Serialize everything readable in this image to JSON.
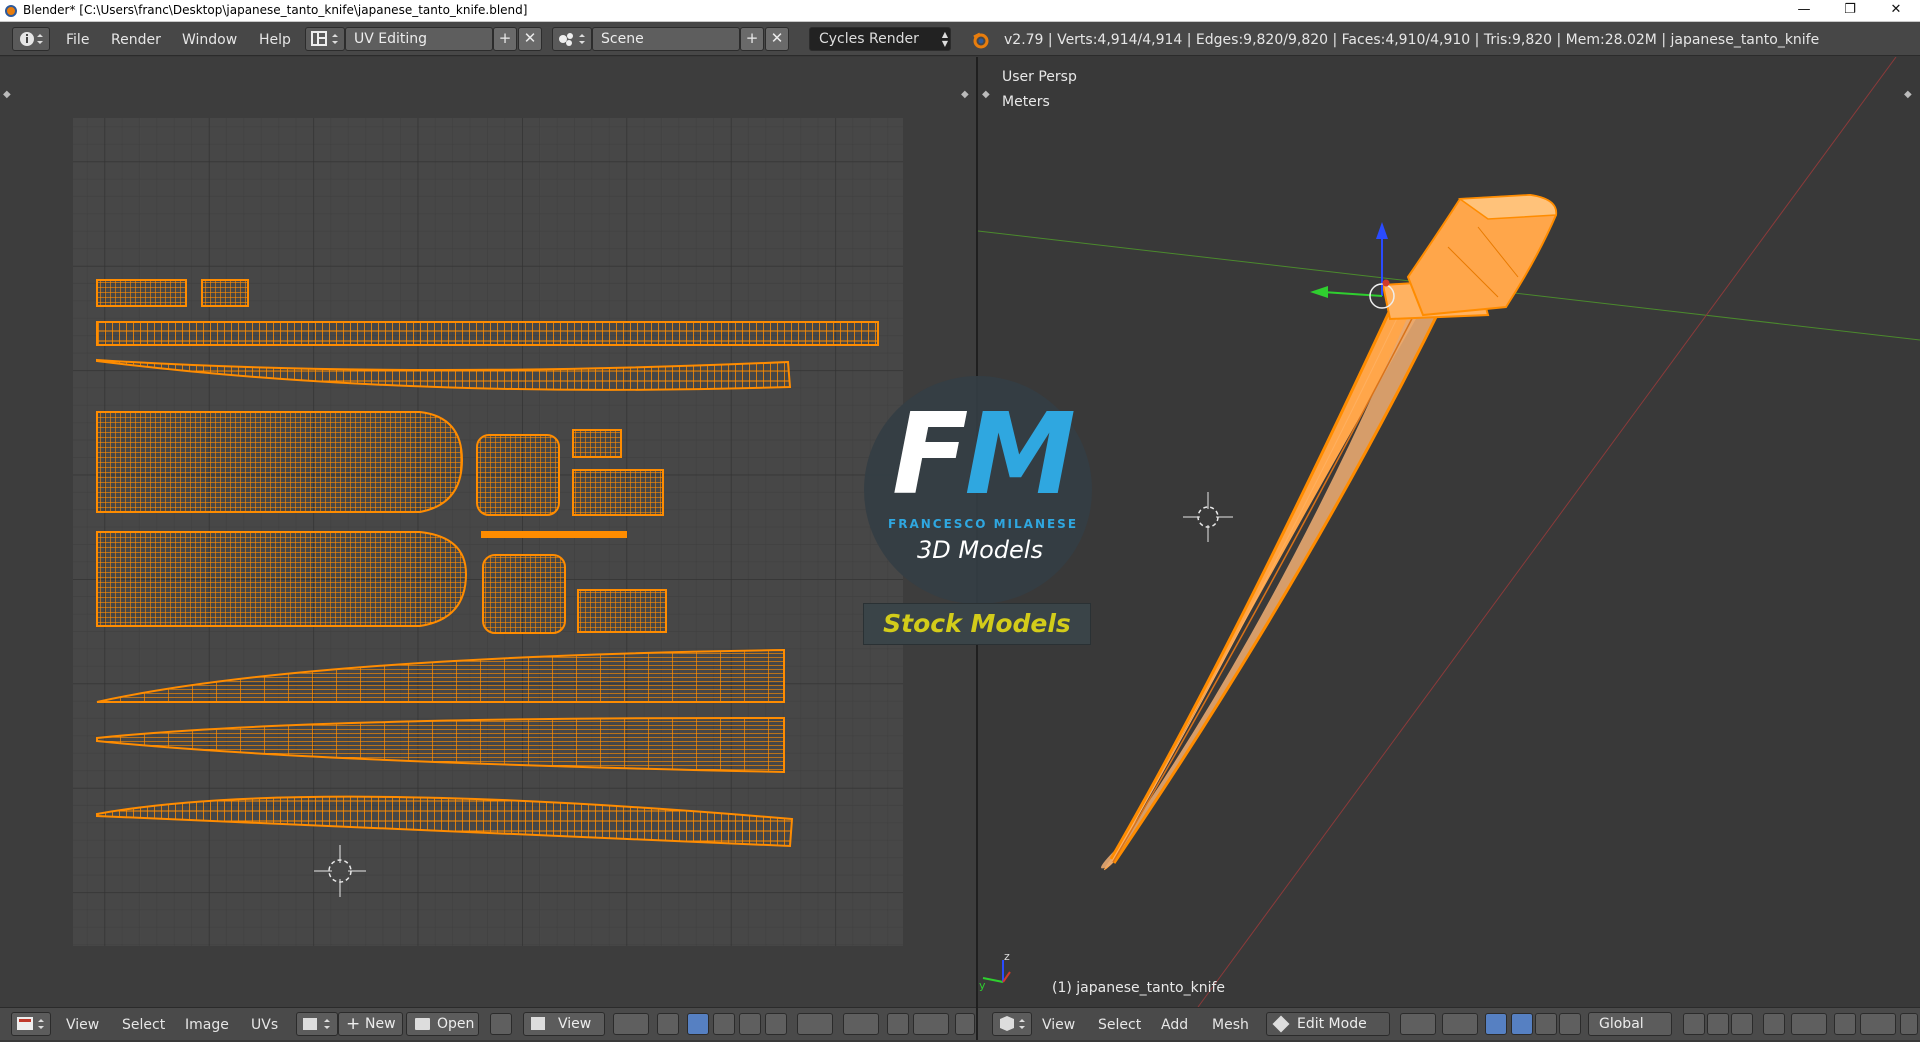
{
  "window": {
    "title": "Blender* [C:\\Users\\franc\\Desktop\\japanese_tanto_knife\\japanese_tanto_knife.blend]",
    "minimize": "—",
    "restore": "❐",
    "close": "✕"
  },
  "menu": {
    "items": [
      "File",
      "Render",
      "Window",
      "Help"
    ],
    "screen_layout": "UV Editing",
    "scene": "Scene",
    "render_engine": "Cycles Render",
    "stats": "v2.79 | Verts:4,914/4,914 | Edges:9,820/9,820 | Faces:4,910/4,910 | Tris:9,820 | Mem:28.02M | japanese_tanto_knife"
  },
  "uv_editor": {
    "menus": [
      "View",
      "Select",
      "Image",
      "UVs"
    ],
    "new_label": "New",
    "open_label": "Open",
    "view_label": "View"
  },
  "viewport": {
    "perspective": "User Persp",
    "units": "Meters",
    "object_label": "(1) japanese_tanto_knife",
    "menus": [
      "View",
      "Select",
      "Add",
      "Mesh"
    ],
    "mode": "Edit Mode",
    "orientation": "Global"
  },
  "watermark": {
    "logo_f": "F",
    "logo_m": "M",
    "brand": "FRANCESCO MILANESE",
    "tagline": "3D Models",
    "banner": "Stock Models"
  },
  "colors": {
    "uv_orange": "#ff8c00",
    "grid_bg": "#474747",
    "brand_blue": "#2fa7e0",
    "banner_yellow": "#d3cc1a",
    "selected_blue": "#5680c2"
  }
}
